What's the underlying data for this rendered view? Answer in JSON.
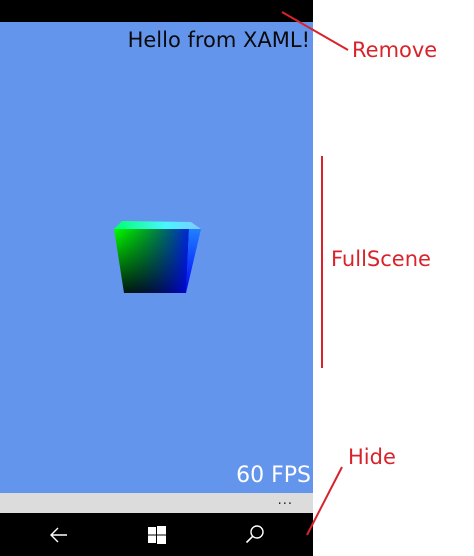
{
  "app": {
    "greeting": "Hello from XAML!",
    "fps_counter": "60 FPS",
    "appbar_more": "..."
  },
  "colors": {
    "scene_background": "#6495ed",
    "annotation": "#d9232b",
    "system_chrome": "#000000",
    "appbar": "#dcdcdc"
  },
  "navigation": {
    "back": "back-arrow-icon",
    "start": "windows-logo-icon",
    "search": "search-icon"
  },
  "annotations": {
    "remove": "Remove",
    "fullscene": "FullScene",
    "hide": "Hide"
  }
}
